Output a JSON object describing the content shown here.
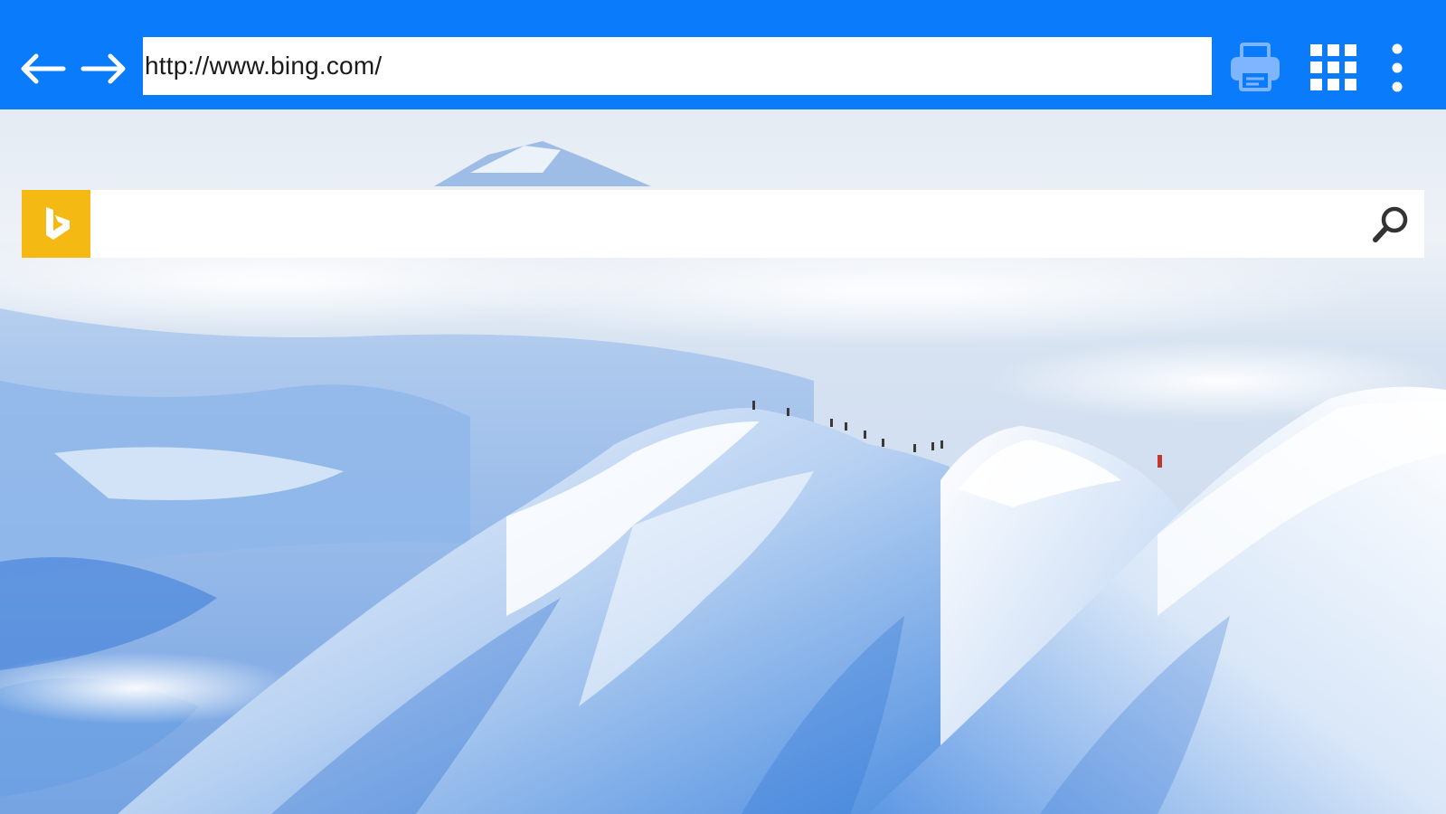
{
  "browser": {
    "address": "http://www.bing.com/",
    "accent_color": "#0a7cfb",
    "icons": {
      "back": "arrow-left-icon",
      "forward": "arrow-right-icon",
      "print": "printer-icon",
      "apps": "grid-icon",
      "menu": "kebab-menu-icon"
    }
  },
  "bing": {
    "logo_color": "#f5b914",
    "search_value": "",
    "icons": {
      "logo": "bing-logo-icon",
      "search": "search-icon"
    }
  },
  "background": {
    "subject": "snowy-mountain-ridge-with-climbers"
  }
}
